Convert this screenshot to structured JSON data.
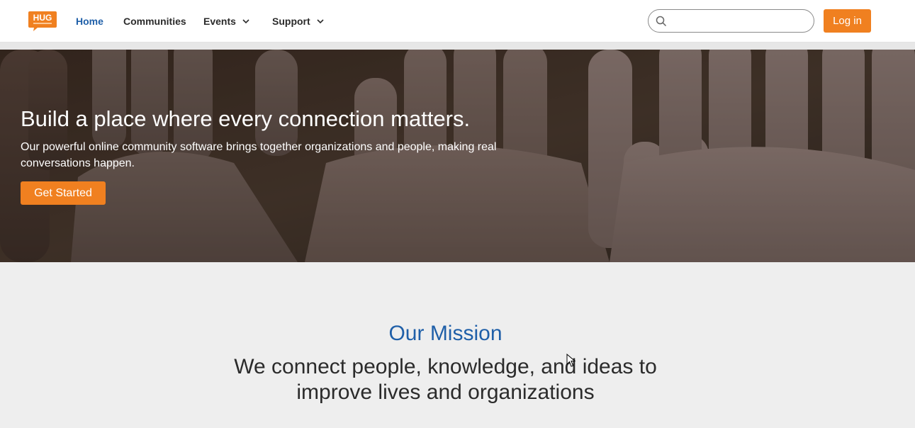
{
  "header": {
    "logo_text": "HUG",
    "nav": [
      {
        "label": "Home",
        "active": true,
        "dropdown": false
      },
      {
        "label": "Communities",
        "active": false,
        "dropdown": false
      },
      {
        "label": "Events",
        "active": false,
        "dropdown": true
      },
      {
        "label": "Support",
        "active": false,
        "dropdown": true
      }
    ],
    "search": {
      "placeholder": "",
      "value": "",
      "icon": "search-icon"
    },
    "login_label": "Log in"
  },
  "hero": {
    "title": "Build a place where every connection matters.",
    "subtitle": "Our powerful online community software brings together organizations and people, making real conversations happen.",
    "cta_label": "Get Started"
  },
  "mission": {
    "heading": "Our Mission",
    "text": "We connect people, knowledge, and ideas to improve lives and organizations"
  },
  "colors": {
    "accent": "#f08020",
    "brand_blue": "#1f5fa8",
    "page_bg": "#eeeeee"
  }
}
